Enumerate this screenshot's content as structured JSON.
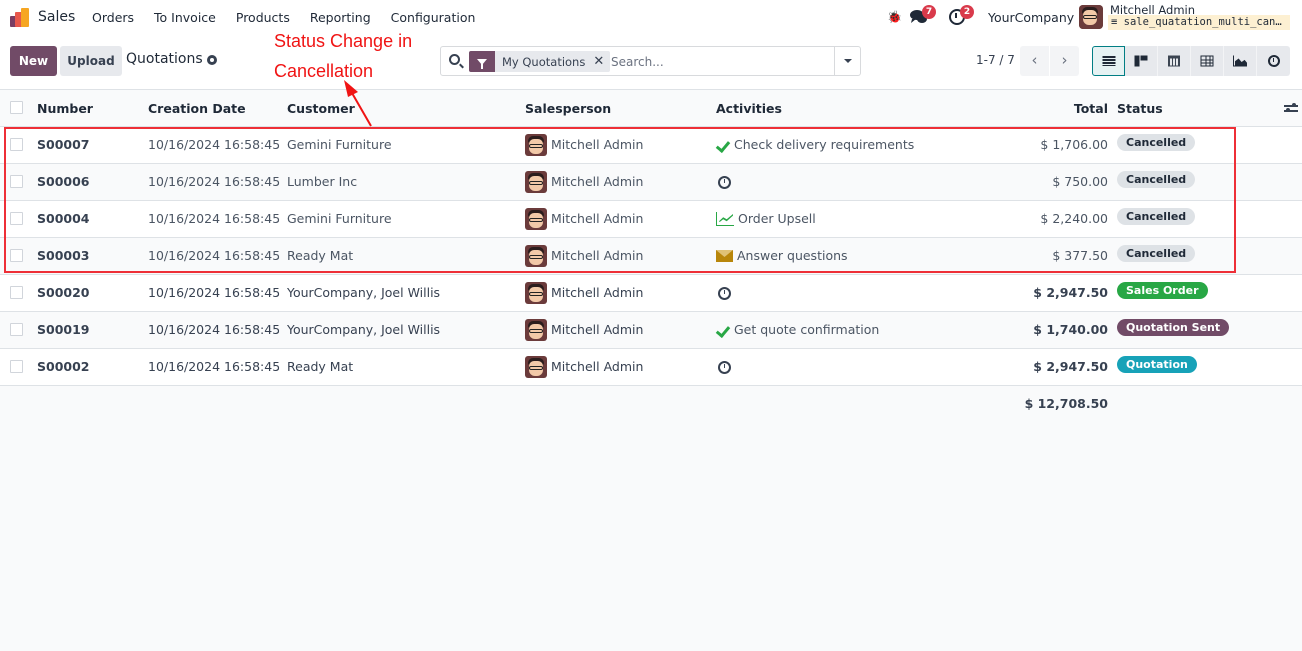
{
  "navbar": {
    "app_name": "Sales",
    "menu": [
      "Orders",
      "To Invoice",
      "Products",
      "Reporting",
      "Configuration"
    ],
    "messages_count": "7",
    "activities_count": "2",
    "company": "YourCompany",
    "user_name": "Mitchell Admin",
    "database": "sale_quatation_multi_can…"
  },
  "control_panel": {
    "new_label": "New",
    "upload_label": "Upload",
    "breadcrumb": "Quotations",
    "search": {
      "facet_label": "My Quotations",
      "placeholder": "Search..."
    },
    "pager": "1-7 / 7",
    "views": [
      "list",
      "kanban",
      "calendar",
      "pivot",
      "graph",
      "activity"
    ],
    "active_view": "list"
  },
  "annotation": {
    "line1": "Status Change in",
    "line2": "Cancellation",
    "color": "#f01414"
  },
  "table": {
    "columns": {
      "number": "Number",
      "creation_date": "Creation Date",
      "customer": "Customer",
      "salesperson": "Salesperson",
      "activities": "Activities",
      "total": "Total",
      "status": "Status"
    },
    "rows": [
      {
        "number": "S00007",
        "date": "10/16/2024 16:58:45",
        "customer": "Gemini Furniture",
        "salesperson": "Mitchell Admin",
        "activity_icon": "check-icon",
        "activity": "Check delivery requirements",
        "total": "$ 1,706.00",
        "status": "Cancelled"
      },
      {
        "number": "S00006",
        "date": "10/16/2024 16:58:45",
        "customer": "Lumber Inc",
        "salesperson": "Mitchell Admin",
        "activity_icon": "clock-icon",
        "activity": "",
        "total": "$ 750.00",
        "status": "Cancelled"
      },
      {
        "number": "S00004",
        "date": "10/16/2024 16:58:45",
        "customer": "Gemini Furniture",
        "salesperson": "Mitchell Admin",
        "activity_icon": "line-chart-icon",
        "activity": "Order Upsell",
        "total": "$ 2,240.00",
        "status": "Cancelled"
      },
      {
        "number": "S00003",
        "date": "10/16/2024 16:58:45",
        "customer": "Ready Mat",
        "salesperson": "Mitchell Admin",
        "activity_icon": "envelope-icon",
        "activity": "Answer questions",
        "total": "$ 377.50",
        "status": "Cancelled"
      },
      {
        "number": "S00020",
        "date": "10/16/2024 16:58:45",
        "customer": "YourCompany, Joel Willis",
        "salesperson": "Mitchell Admin",
        "activity_icon": "clock-icon",
        "activity": "",
        "total": "$ 2,947.50",
        "status": "Sales Order"
      },
      {
        "number": "S00019",
        "date": "10/16/2024 16:58:45",
        "customer": "YourCompany, Joel Willis",
        "salesperson": "Mitchell Admin",
        "activity_icon": "check-icon",
        "activity": "Get quote confirmation",
        "total": "$ 1,740.00",
        "status": "Quotation Sent"
      },
      {
        "number": "S00002",
        "date": "10/16/2024 16:58:45",
        "customer": "Ready Mat",
        "salesperson": "Mitchell Admin",
        "activity_icon": "clock-icon",
        "activity": "",
        "total": "$ 2,947.50",
        "status": "Quotation"
      }
    ],
    "grand_total": "$ 12,708.50"
  },
  "colors": {
    "brand": "#714b67",
    "cancelled": "#dee2e6",
    "sales_order": "#28a745",
    "quotation_sent": "#714b67",
    "quotation": "#17a2b8",
    "highlight": "#ee2f37"
  }
}
